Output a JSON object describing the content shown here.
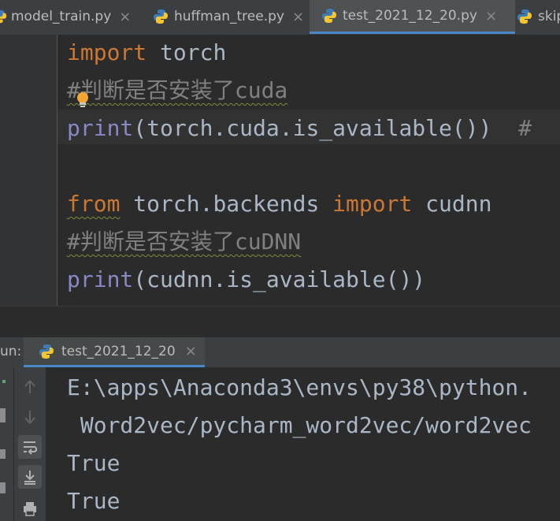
{
  "tabs": [
    {
      "label": "model_train.py",
      "close": "×"
    },
    {
      "label": "huffman_tree.py",
      "close": "×"
    },
    {
      "label": "test_2021_12_20.py",
      "close": "×"
    },
    {
      "label": "skip"
    }
  ],
  "code": {
    "line1": {
      "kw": "import",
      "rest": " torch"
    },
    "line2": {
      "comment": "#判断是否安装了cuda"
    },
    "line3": {
      "fn": "print",
      "rest": "(torch.cuda.is_available())  ",
      "trail": "#"
    },
    "line5": {
      "kw1": "from",
      "mid": " torch.backends ",
      "kw2": "import",
      "rest": " cudnn"
    },
    "line6": {
      "comment": "#判断是否安装了cuDNN"
    },
    "line7": {
      "fn": "print",
      "rest": "(cudnn.is_available())"
    }
  },
  "run": {
    "label": "un:",
    "tab_label": "test_2021_12_20",
    "tab_close": "×"
  },
  "console": {
    "lines": [
      "E:\\apps\\Anaconda3\\envs\\py38\\python.",
      " Word2vec/pycharm_word2vec/word2vec",
      "True",
      "True"
    ]
  },
  "colors": {
    "keyword": "#cc7832",
    "builtin": "#8888c6",
    "comment": "#808080",
    "text": "#a9b7c6",
    "accent": "#4a88c7"
  },
  "icons": [
    "python-file-icon",
    "close-icon",
    "intention-bulb-icon",
    "up-arrow-icon",
    "down-arrow-icon",
    "soft-wrap-icon",
    "scroll-to-end-icon",
    "print-icon"
  ]
}
